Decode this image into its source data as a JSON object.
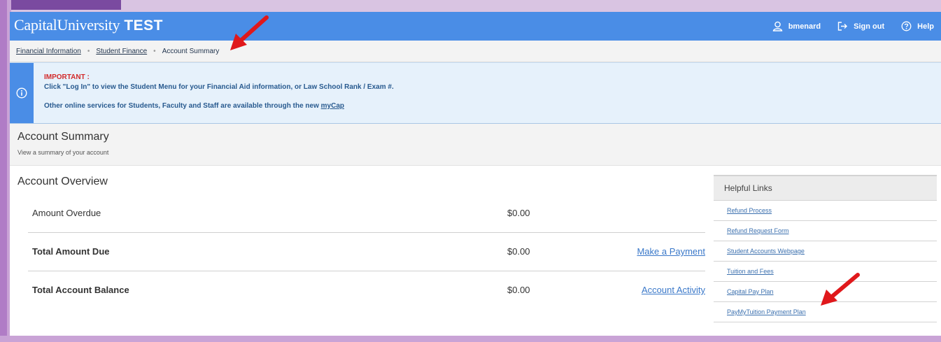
{
  "header": {
    "brand": "CapitalUniversity",
    "env_tag": "TEST",
    "user": "bmenard",
    "sign_out": "Sign out",
    "help": "Help"
  },
  "breadcrumb": {
    "items": [
      "Financial Information",
      "Student Finance"
    ],
    "current": "Account Summary"
  },
  "notice": {
    "important": "IMPORTANT",
    "colon": " :",
    "line1": "Click \"Log In\" to view the Student Menu for your Financial Aid information, or Law School Rank / Exam #.",
    "line2_prefix": "Other online services for Students, Faculty and Staff are available through the new ",
    "line2_link": "myCap"
  },
  "page": {
    "title": "Account Summary",
    "subtitle": "View a summary of your account"
  },
  "overview": {
    "title": "Account Overview",
    "rows": [
      {
        "label": "Amount Overdue",
        "amount": "$0.00",
        "action": ""
      },
      {
        "label": "Total Amount Due",
        "amount": "$0.00",
        "action": "Make a Payment"
      },
      {
        "label": "Total Account Balance",
        "amount": "$0.00",
        "action": "Account Activity"
      }
    ]
  },
  "helpful_links": {
    "title": "Helpful Links",
    "items": [
      "Refund Process",
      "Refund Request Form",
      "Student Accounts Webpage",
      "Tuition and Fees",
      "Capital Pay Plan",
      "PayMyTuition Payment Plan"
    ]
  },
  "colors": {
    "header_bg": "#4a8de6",
    "notice_bg": "#e6f1fb",
    "important_red": "#d22b2b",
    "arrow_red": "#e0181b",
    "frame_purple": "#c9a3d6"
  }
}
